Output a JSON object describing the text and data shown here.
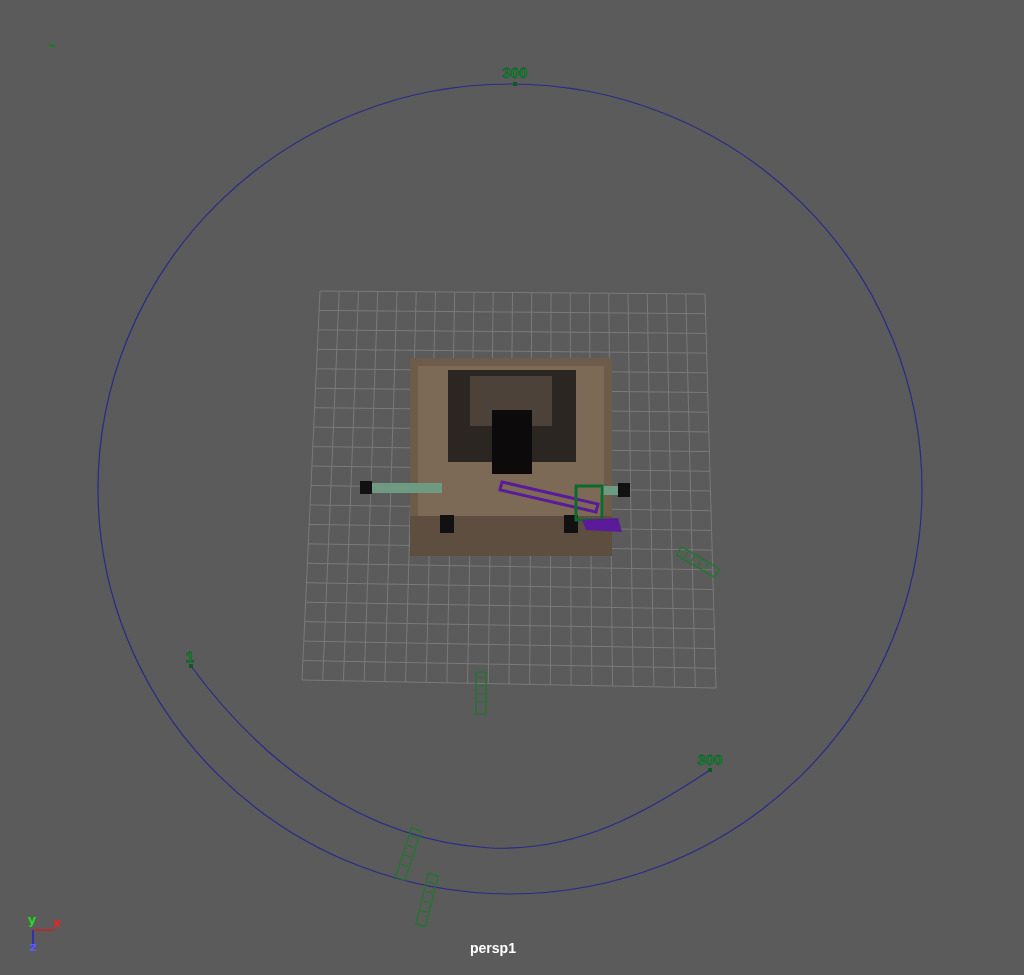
{
  "viewport": {
    "camera": "persp1",
    "curve_labels": [
      "300",
      "1",
      "300"
    ],
    "axis_labels": [
      "y",
      "x",
      "z"
    ]
  }
}
